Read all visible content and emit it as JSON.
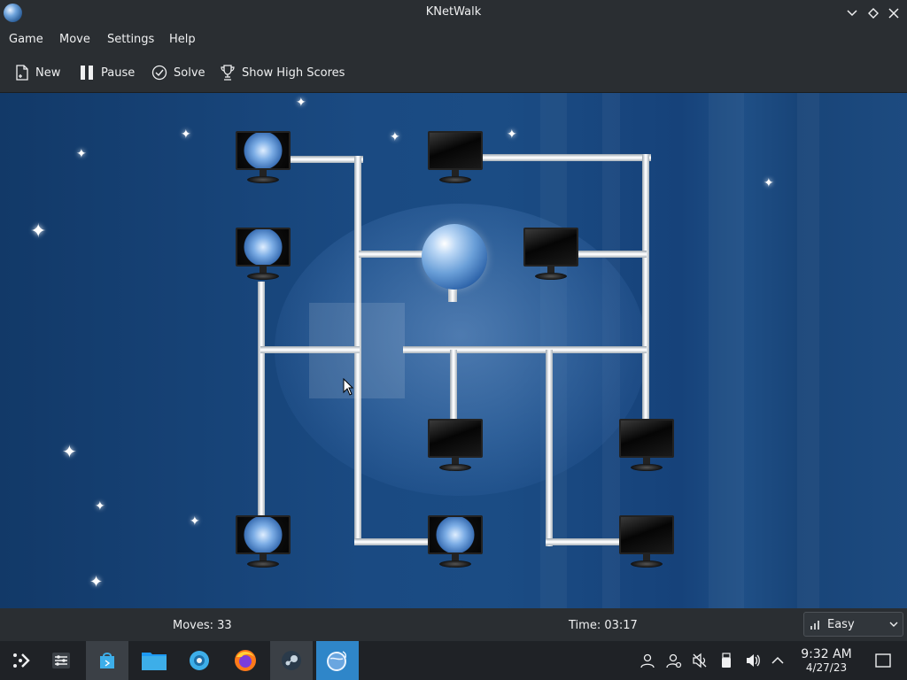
{
  "window": {
    "title": "KNetWalk"
  },
  "menu": {
    "items": [
      "Game",
      "Move",
      "Settings",
      "Help"
    ]
  },
  "toolbar": {
    "new_label": "New",
    "pause_label": "Pause",
    "solve_label": "Solve",
    "highscores_label": "Show High Scores"
  },
  "status": {
    "moves": "Moves: 33",
    "time": "Time: 03:17",
    "difficulty": "Easy"
  },
  "clock": {
    "time": "9:32 AM",
    "date": "4/27/23"
  },
  "colors": {
    "accent": "#2f86c9",
    "board": "#1a4a82",
    "chrome": "#2a2e32"
  },
  "icons": {
    "taskbar": [
      "launcher-icon",
      "settings-sliders-icon",
      "discover-store-icon",
      "file-manager-icon",
      "system-settings-icon",
      "firefox-icon",
      "steam-icon",
      "knetwalk-icon"
    ],
    "tray": [
      "user-icon",
      "user-switch-icon",
      "volume-muted-icon",
      "usb-drive-icon",
      "volume-icon",
      "expand-tray-icon",
      "show-desktop-icon"
    ]
  }
}
